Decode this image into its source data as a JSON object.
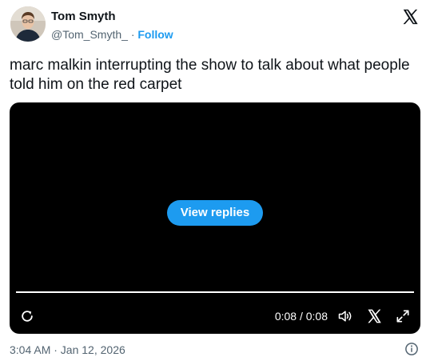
{
  "author": {
    "name": "Tom Smyth",
    "handle": "@Tom_Smyth_",
    "separator": "·",
    "follow_label": "Follow"
  },
  "tweet": {
    "text": "marc malkin interrupting the show to talk about what people told him on the red carpet"
  },
  "video": {
    "view_replies_label": "View replies",
    "time_display": "0:08 / 0:08",
    "progress": 1.0,
    "icons": {
      "replay": "replay-icon",
      "volume": "volume-icon",
      "x": "x-logo-icon",
      "fullscreen": "fullscreen-icon"
    }
  },
  "footer": {
    "timestamp": "3:04 AM · Jan 12, 2026",
    "info_icon": "info-icon"
  },
  "colors": {
    "accent": "#1d9bf0",
    "text": "#0f1419",
    "muted": "#536471",
    "video_bg": "#000000"
  }
}
